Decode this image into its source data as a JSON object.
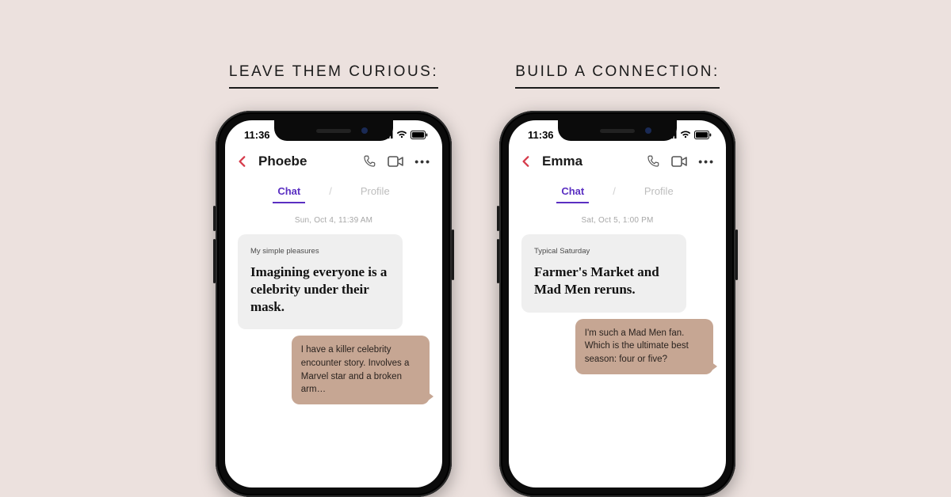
{
  "columns": [
    {
      "heading": "LEAVE THEM CURIOUS:",
      "statusbar_time": "11:36",
      "contact_name": "Phoebe",
      "tabs": {
        "chat": "Chat",
        "profile": "Profile"
      },
      "timestamp": "Sun, Oct 4, 11:39 AM",
      "prompt_label": "My simple pleasures",
      "prompt_text": "Imagining everyone is a celebrity under their mask.",
      "reply": "I have a killer celebrity encounter story. Involves a Marvel star and a broken arm…"
    },
    {
      "heading": "BUILD A CONNECTION:",
      "statusbar_time": "11:36",
      "contact_name": "Emma",
      "tabs": {
        "chat": "Chat",
        "profile": "Profile"
      },
      "timestamp": "Sat, Oct 5, 1:00 PM",
      "prompt_label": "Typical Saturday",
      "prompt_text": "Farmer's Market and Mad Men reruns.",
      "reply": "I'm such a Mad Men fan. Which is the ultimate best season: four or five?"
    }
  ],
  "icons": {
    "more": "•••"
  }
}
